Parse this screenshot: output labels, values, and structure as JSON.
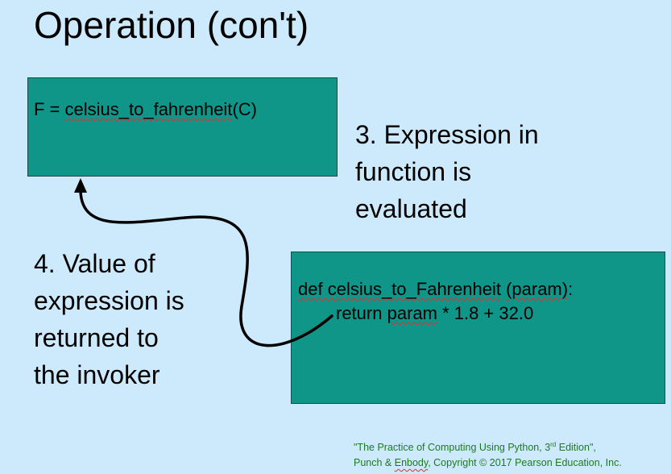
{
  "slide": {
    "title": "Operation (con't)",
    "call_box": {
      "prefix": "F = ",
      "func": "celsius_to_fahrenheit",
      "suffix": "(C)"
    },
    "def_box": {
      "def_kw": "def ",
      "func": "celsius_to_Fahrenheit",
      "space": " ",
      "param": "(param)",
      "colon": ":",
      "return_kw": "return ",
      "return_param": "param",
      "return_expr": " * 1.8 + 32.0"
    },
    "step3": {
      "line1": "3. Expression in",
      "line2": "function is",
      "line3": "evaluated"
    },
    "step4": {
      "line1": "4. Value of",
      "line2": "expression is",
      "line3": "returned to",
      "line4": "the invoker"
    },
    "citation": {
      "line1_a": "\"The Practice of Computing Using Python, 3",
      "line1_sup": "rd",
      "line1_b": " Edition\",",
      "line2_a": "Punch & ",
      "line2_name": "Enbody",
      "line2_b": ", Copyright © 2017 Pearson Education, Inc."
    },
    "colors": {
      "background": "#cdeafc",
      "box_fill": "#0f9689",
      "citation_text": "#1e7a1e",
      "arrow": "#000000"
    },
    "icons": {
      "return_arrow": "curved-arrow-up"
    }
  }
}
